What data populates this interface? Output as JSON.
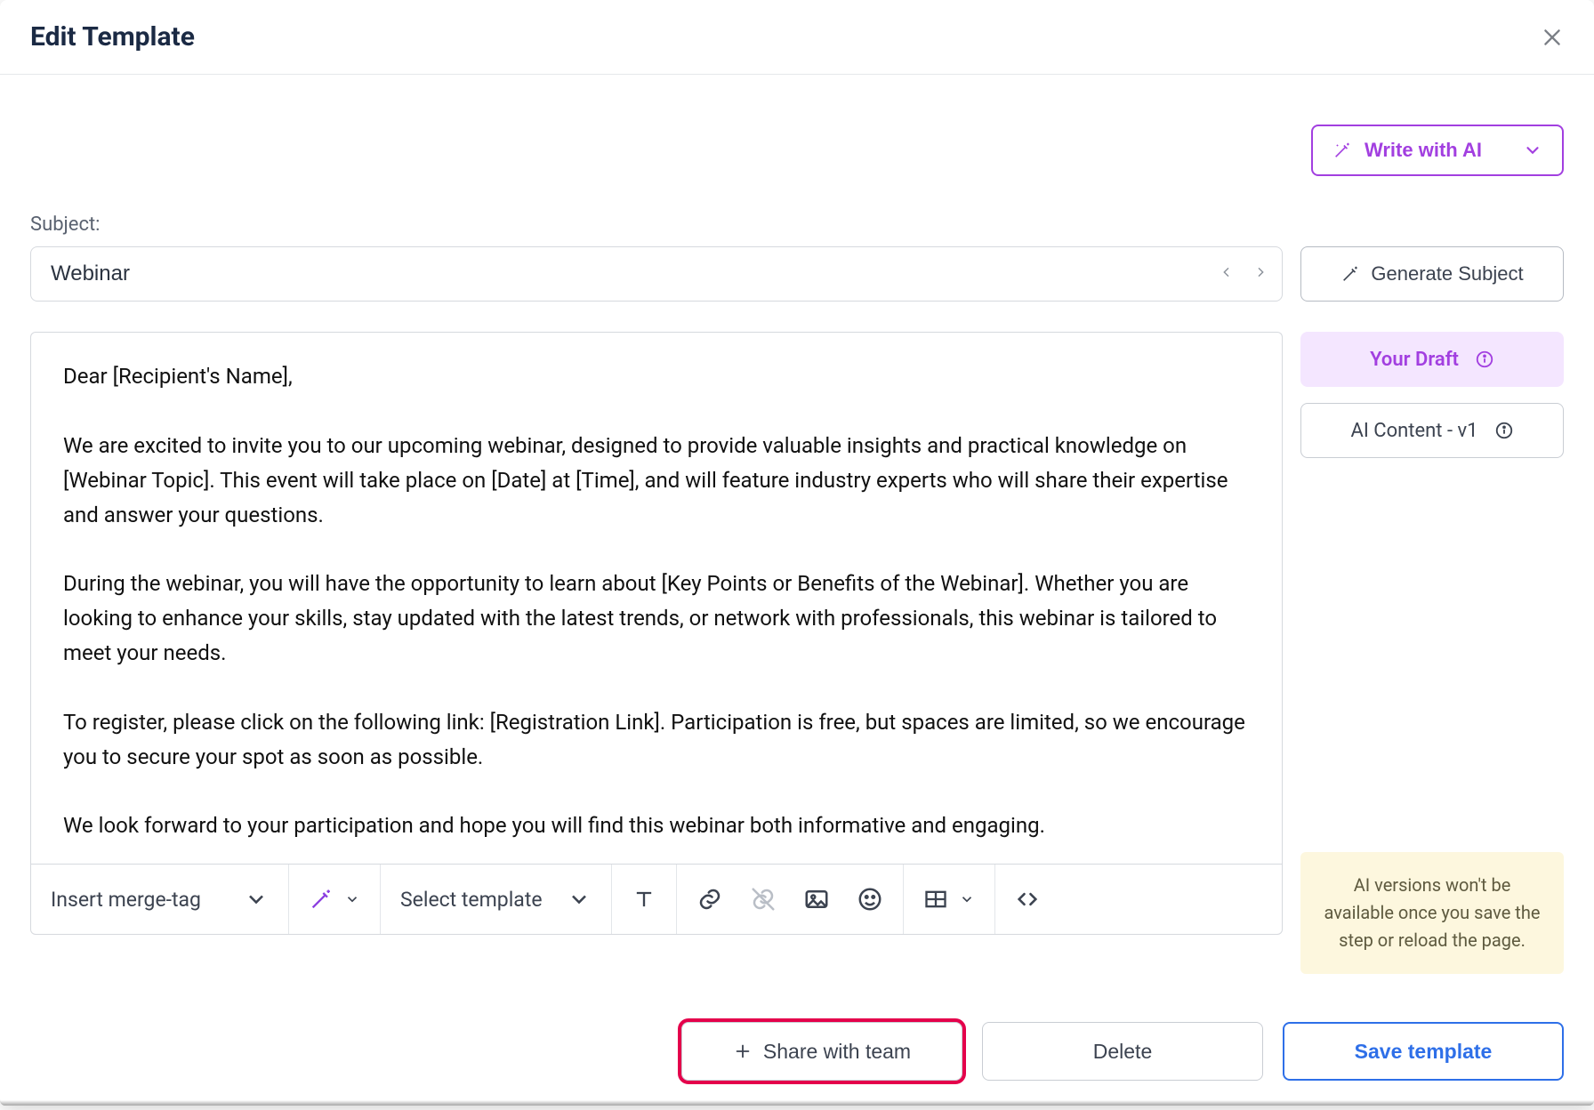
{
  "header": {
    "title": "Edit Template"
  },
  "ai": {
    "write_label": "Write with AI",
    "generate_subject_label": "Generate Subject",
    "draft_label": "Your Draft",
    "version_label": "AI Content - v1",
    "warn_text": "AI versions won't be available once you save the step or reload the page."
  },
  "subject": {
    "label": "Subject:",
    "value": "Webinar"
  },
  "editor": {
    "body": "Dear [Recipient's Name],\n\nWe are excited to invite you to our upcoming webinar, designed to provide valuable insights and practical knowledge on [Webinar Topic]. This event will take place on [Date] at [Time], and will feature industry experts who will share their expertise and answer your questions.\n\nDuring the webinar, you will have the opportunity to learn about [Key Points or Benefits of the Webinar]. Whether you are looking to enhance your skills, stay updated with the latest trends, or network with professionals, this webinar is tailored to meet your needs.\n\nTo register, please click on the following link: [Registration Link]. Participation is free, but spaces are limited, so we encourage you to secure your spot as soon as possible.\n\nWe look forward to your participation and hope you will find this webinar both informative and engaging."
  },
  "toolbar": {
    "merge_tag_label": "Insert merge-tag",
    "select_template_label": "Select template"
  },
  "footer": {
    "share_label": "Share with team",
    "delete_label": "Delete",
    "save_label": "Save template"
  }
}
